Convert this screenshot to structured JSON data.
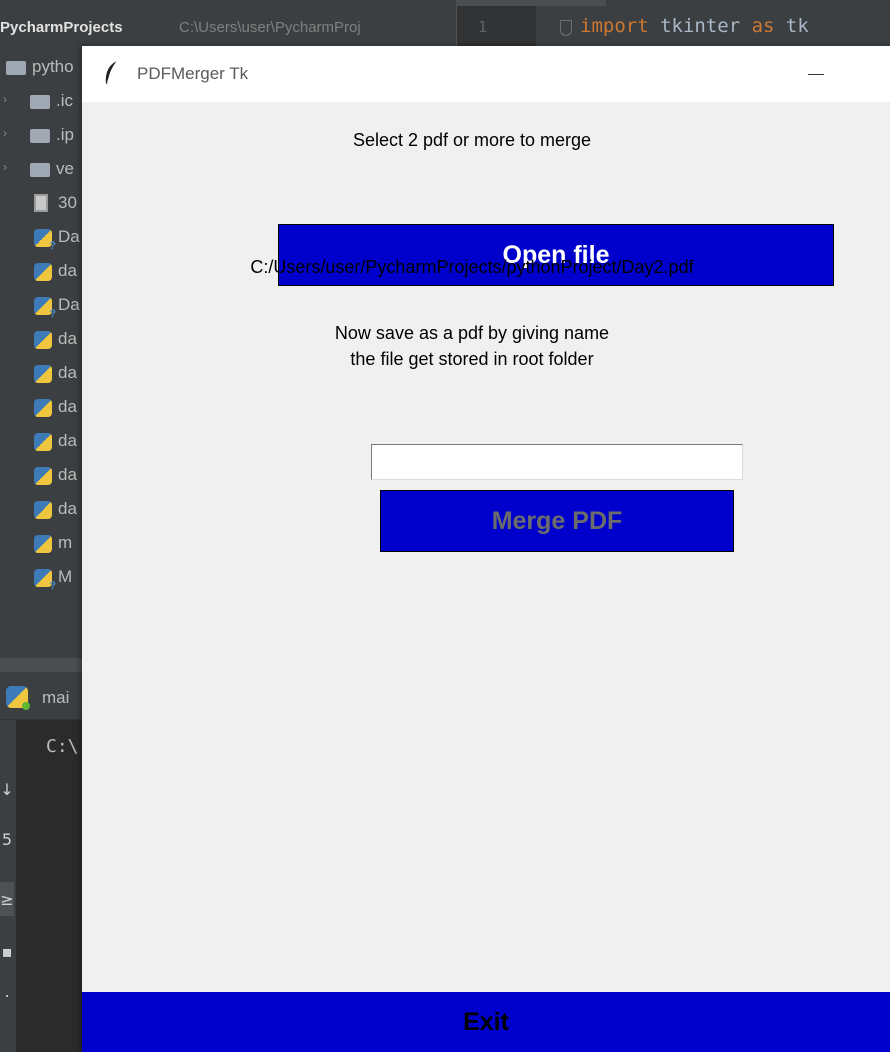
{
  "ide": {
    "project_title": "PycharmProjects",
    "project_path": "C:\\Users\\user\\PycharmProj",
    "line_number": "1",
    "code": {
      "kw1": "import",
      "mid": " tkinter ",
      "kw2": "as",
      "tail": " tk"
    },
    "tree": [
      {
        "type": "folder",
        "label": "pytho"
      },
      {
        "type": "folder",
        "label": ".ic",
        "arrow": "›"
      },
      {
        "type": "folder",
        "label": ".ip",
        "arrow": "›"
      },
      {
        "type": "folder",
        "label": "ve",
        "arrow": "›"
      },
      {
        "type": "text",
        "label": "30"
      },
      {
        "type": "py-unknown",
        "label": "Da"
      },
      {
        "type": "py",
        "label": "da"
      },
      {
        "type": "py-unknown",
        "label": "Da"
      },
      {
        "type": "py",
        "label": "da"
      },
      {
        "type": "py",
        "label": "da"
      },
      {
        "type": "py",
        "label": "da"
      },
      {
        "type": "py",
        "label": "da"
      },
      {
        "type": "py",
        "label": "da"
      },
      {
        "type": "py",
        "label": "da"
      },
      {
        "type": "py",
        "label": "m"
      },
      {
        "type": "py-unknown",
        "label": "M"
      }
    ],
    "run_tab_label": "mai",
    "console_text": "C:\\",
    "tool_glyphs": [
      "↓",
      "5",
      "≥",
      "▪",
      "."
    ]
  },
  "window": {
    "title": "PDFMerger Tk",
    "select_label": "Select 2 pdf or more to merge",
    "open_button": "Open file",
    "selected_path": "C:/Users/user/PycharmProjects/pythonProject/Day2.pdf",
    "save_line1": "Now save as a pdf by giving name",
    "save_line2": "the file get stored in root folder",
    "name_input_value": "",
    "merge_button": "Merge PDF",
    "exit_button": "Exit"
  },
  "colors": {
    "button_blue": "#0000cc",
    "window_bg": "#f0f0f0",
    "ide_bg": "#2b2b2b"
  }
}
